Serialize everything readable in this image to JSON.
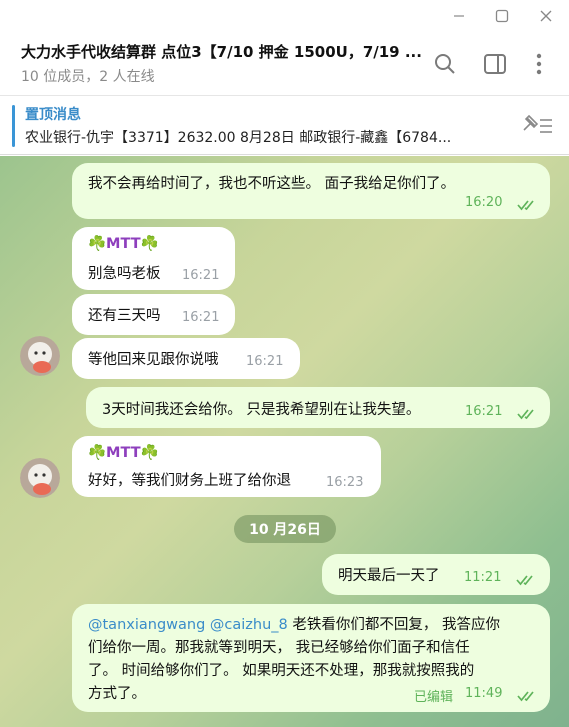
{
  "window": {
    "icons": [
      "minimize-icon",
      "maximize-icon",
      "close-icon"
    ]
  },
  "header": {
    "title": "大力水手代收结算群 点位3【7/10 押金 1500U，7/19 ...",
    "subtitle": "10 位成员，2 人在线"
  },
  "pinned": {
    "title": "置顶消息",
    "text": "农业银行-仇宇【3371】2632.00   8月28日 邮政银行-藏鑫【6784..."
  },
  "messages": [
    {
      "type": "out",
      "text": "我不会再给时间了，我也不听这些。 面子我给足你们了。",
      "time": "16:20"
    },
    {
      "type": "in",
      "sender": "☘️MTT☘️",
      "text": "别急吗老板",
      "time": "16:21"
    },
    {
      "type": "in",
      "text": "还有三天吗",
      "time": "16:21"
    },
    {
      "type": "in",
      "text": "等他回来见跟你说哦",
      "time": "16:21"
    },
    {
      "type": "out",
      "text": "3天时间我还会给你。 只是我希望别在让我失望。",
      "time": "16:21"
    },
    {
      "type": "in",
      "sender": "☘️MTT☘️",
      "text": "好好，等我们财务上班了给你退",
      "time": "16:23"
    },
    {
      "type": "date",
      "text": "10 月26日"
    },
    {
      "type": "out",
      "text": "明天最后一天了",
      "time": "11:21"
    },
    {
      "type": "out",
      "mention1": "@tanxiangwang",
      "mention2": "@caizhu_8",
      "line1_rest": " 老铁看你们都不回复， 我答应你",
      "line2": "们给你一周。那我就等到明天， 我已经够给你们面子和信任",
      "line3": "了。 时间给够你们了。  如果明天还不处理，那我就按照我的",
      "line4": "方式了。",
      "edited": "已编辑",
      "time": "11:49"
    }
  ]
}
